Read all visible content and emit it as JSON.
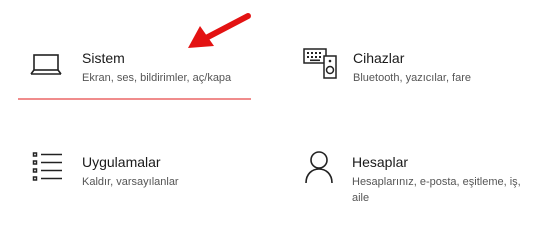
{
  "tiles": [
    {
      "title": "Sistem",
      "description": "Ekran, ses, bildirimler, aç/kapa",
      "icon": "laptop-icon",
      "selected": true
    },
    {
      "title": "Cihazlar",
      "description": "Bluetooth, yazıcılar, fare",
      "icon": "devices-icon",
      "selected": false
    },
    {
      "title": "Uygulamalar",
      "description": "Kaldır, varsayılanlar",
      "icon": "apps-list-icon",
      "selected": false
    },
    {
      "title": "Hesaplar",
      "description": "Hesaplarınız, e-posta, eşitleme, iş, aile",
      "icon": "person-icon",
      "selected": false
    }
  ],
  "colors": {
    "selected_underline": "#f08c8c",
    "annotation_arrow": "#e31212"
  }
}
